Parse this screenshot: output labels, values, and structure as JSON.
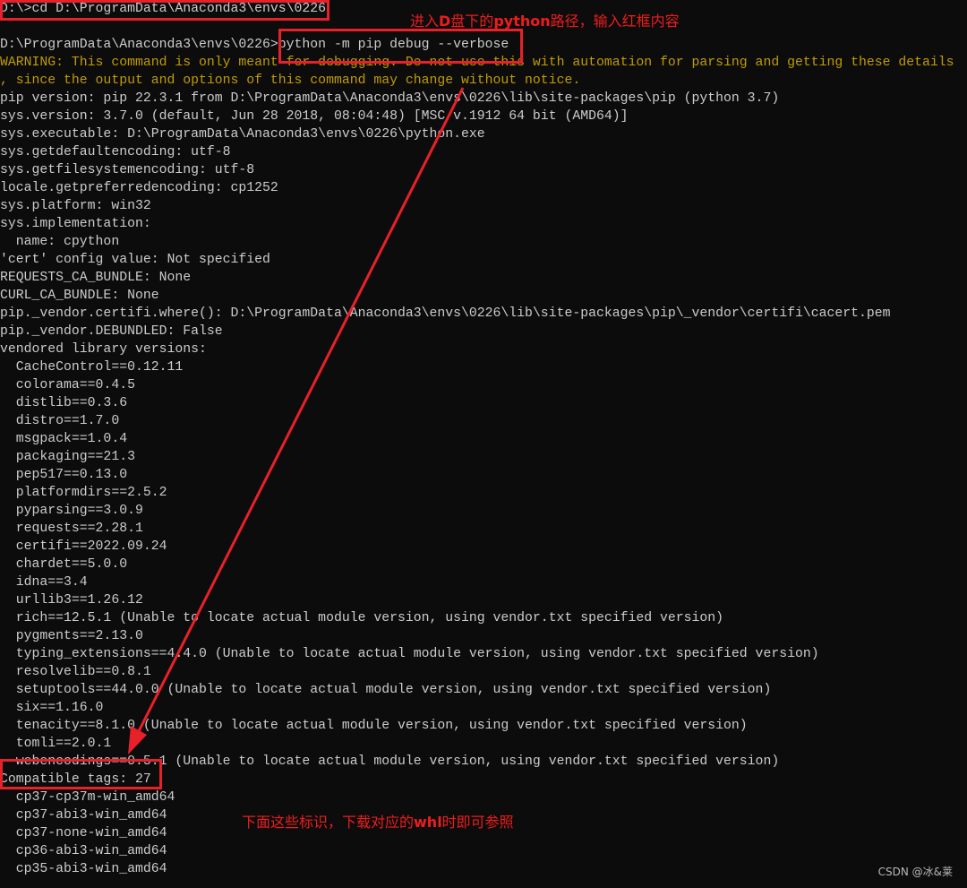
{
  "terminal": {
    "lines": [
      {
        "text": "D:\\>cd D:\\ProgramData\\Anaconda3\\envs\\0226",
        "type": "normal"
      },
      {
        "text": "",
        "type": "normal"
      },
      {
        "text": "D:\\ProgramData\\Anaconda3\\envs\\0226>python -m pip debug --verbose",
        "type": "normal"
      },
      {
        "text": "WARNING: This command is only meant for debugging. Do not use this with automation for parsing and getting these details",
        "type": "warning"
      },
      {
        "text": ", since the output and options of this command may change without notice.",
        "type": "warning"
      },
      {
        "text": "pip version: pip 22.3.1 from D:\\ProgramData\\Anaconda3\\envs\\0226\\lib\\site-packages\\pip (python 3.7)",
        "type": "normal"
      },
      {
        "text": "sys.version: 3.7.0 (default, Jun 28 2018, 08:04:48) [MSC v.1912 64 bit (AMD64)]",
        "type": "normal"
      },
      {
        "text": "sys.executable: D:\\ProgramData\\Anaconda3\\envs\\0226\\python.exe",
        "type": "normal"
      },
      {
        "text": "sys.getdefaultencoding: utf-8",
        "type": "normal"
      },
      {
        "text": "sys.getfilesystemencoding: utf-8",
        "type": "normal"
      },
      {
        "text": "locale.getpreferredencoding: cp1252",
        "type": "normal"
      },
      {
        "text": "sys.platform: win32",
        "type": "normal"
      },
      {
        "text": "sys.implementation:",
        "type": "normal"
      },
      {
        "text": "  name: cpython",
        "type": "normal"
      },
      {
        "text": "'cert' config value: Not specified",
        "type": "normal"
      },
      {
        "text": "REQUESTS_CA_BUNDLE: None",
        "type": "normal"
      },
      {
        "text": "CURL_CA_BUNDLE: None",
        "type": "normal"
      },
      {
        "text": "pip._vendor.certifi.where(): D:\\ProgramData\\Anaconda3\\envs\\0226\\lib\\site-packages\\pip\\_vendor\\certifi\\cacert.pem",
        "type": "normal"
      },
      {
        "text": "pip._vendor.DEBUNDLED: False",
        "type": "normal"
      },
      {
        "text": "vendored library versions:",
        "type": "normal"
      },
      {
        "text": "  CacheControl==0.12.11",
        "type": "normal"
      },
      {
        "text": "  colorama==0.4.5",
        "type": "normal"
      },
      {
        "text": "  distlib==0.3.6",
        "type": "normal"
      },
      {
        "text": "  distro==1.7.0",
        "type": "normal"
      },
      {
        "text": "  msgpack==1.0.4",
        "type": "normal"
      },
      {
        "text": "  packaging==21.3",
        "type": "normal"
      },
      {
        "text": "  pep517==0.13.0",
        "type": "normal"
      },
      {
        "text": "  platformdirs==2.5.2",
        "type": "normal"
      },
      {
        "text": "  pyparsing==3.0.9",
        "type": "normal"
      },
      {
        "text": "  requests==2.28.1",
        "type": "normal"
      },
      {
        "text": "  certifi==2022.09.24",
        "type": "normal"
      },
      {
        "text": "  chardet==5.0.0",
        "type": "normal"
      },
      {
        "text": "  idna==3.4",
        "type": "normal"
      },
      {
        "text": "  urllib3==1.26.12",
        "type": "normal"
      },
      {
        "text": "  rich==12.5.1 (Unable to locate actual module version, using vendor.txt specified version)",
        "type": "normal"
      },
      {
        "text": "  pygments==2.13.0",
        "type": "normal"
      },
      {
        "text": "  typing_extensions==4.4.0 (Unable to locate actual module version, using vendor.txt specified version)",
        "type": "normal"
      },
      {
        "text": "  resolvelib==0.8.1",
        "type": "normal"
      },
      {
        "text": "  setuptools==44.0.0 (Unable to locate actual module version, using vendor.txt specified version)",
        "type": "normal"
      },
      {
        "text": "  six==1.16.0",
        "type": "normal"
      },
      {
        "text": "  tenacity==8.1.0 (Unable to locate actual module version, using vendor.txt specified version)",
        "type": "normal"
      },
      {
        "text": "  tomli==2.0.1",
        "type": "normal"
      },
      {
        "text": "  webencodings==0.5.1 (Unable to locate actual module version, using vendor.txt specified version)",
        "type": "normal"
      },
      {
        "text": "Compatible tags: 27",
        "type": "normal"
      },
      {
        "text": "  cp37-cp37m-win_amd64",
        "type": "normal"
      },
      {
        "text": "  cp37-abi3-win_amd64",
        "type": "normal"
      },
      {
        "text": "  cp37-none-win_amd64",
        "type": "normal"
      },
      {
        "text": "  cp36-abi3-win_amd64",
        "type": "normal"
      },
      {
        "text": "  cp35-abi3-win_amd64",
        "type": "normal"
      }
    ]
  },
  "annotations": {
    "note_top": {
      "pre": "进入",
      "bold1": "D",
      "mid": "盘下的",
      "bold2": "python",
      "post": "路径，输入红框内容"
    },
    "note_bottom": {
      "pre": "下面这些标识，下载对应的",
      "bold": "whl",
      "post": "时即可参照"
    }
  },
  "watermark": "CSDN @冰&莱",
  "colors": {
    "background": "#0c0c0c",
    "text": "#cccccc",
    "warning": "#c19c00",
    "annotation": "#e8202a"
  }
}
